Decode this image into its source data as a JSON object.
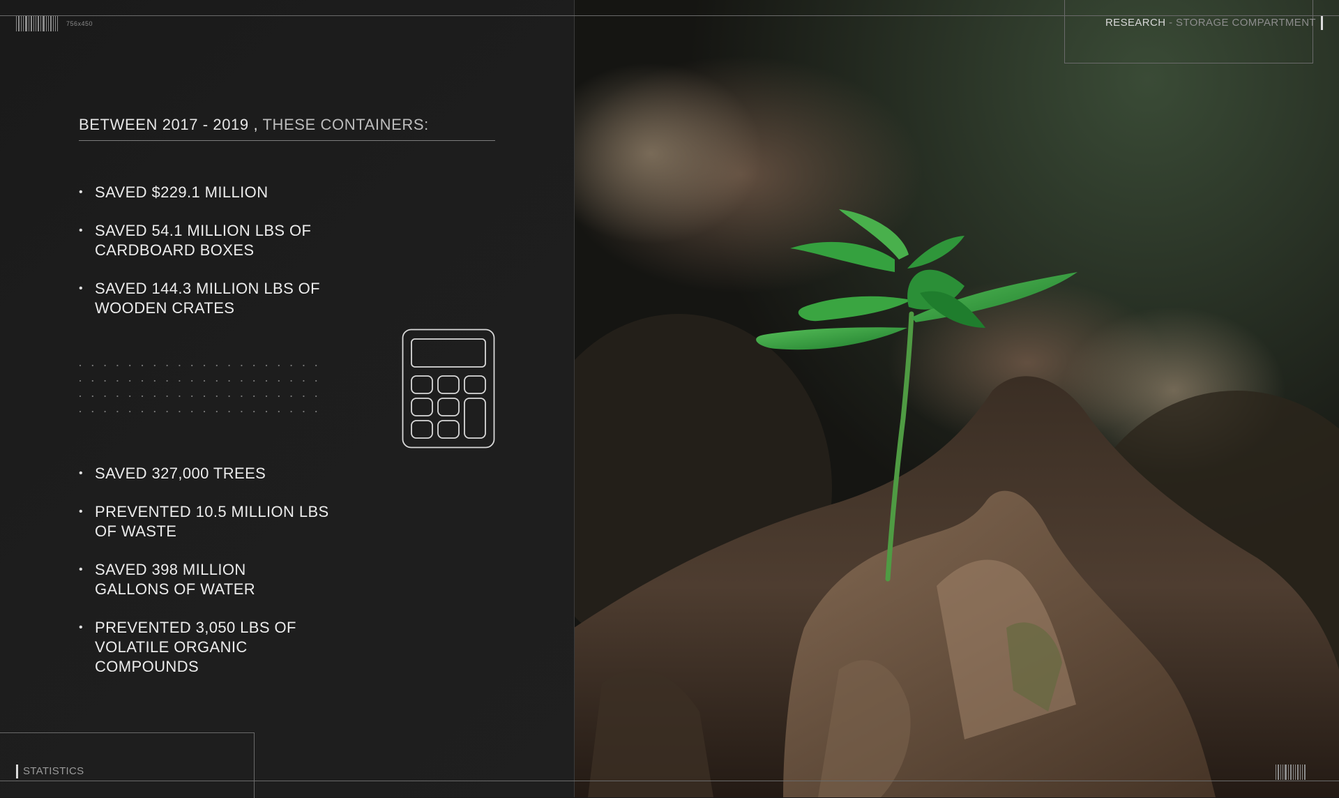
{
  "header": {
    "dimensions_label": "756x450",
    "section_bold": "RESEARCH",
    "section_separator": " - ",
    "section_light": "STORAGE COMPARTMENT"
  },
  "heading": {
    "bold": "BETWEEN 2017 - 2019 ,",
    "light": " THESE CONTAINERS:"
  },
  "stats_top": [
    {
      "line1": "SAVED $229.1 MILLION",
      "line2": ""
    },
    {
      "line1": "SAVED 54.1 MILLION LBS OF",
      "line2": "CARDBOARD BOXES"
    },
    {
      "line1": "SAVED 144.3 MILLION LBS OF",
      "line2": "WOODEN CRATES"
    }
  ],
  "stats_bottom": [
    {
      "line1": "SAVED 327,000 TREES",
      "line2": "",
      "line3": ""
    },
    {
      "line1": "PREVENTED 10.5 MILLION LBS",
      "line2": "OF WASTE",
      "line3": ""
    },
    {
      "line1": "SAVED 398 MILLION",
      "line2": "GALLONS OF WATER",
      "line3": ""
    },
    {
      "line1": "PREVENTED 3,050 LBS OF",
      "line2": "VOLATILE ORGANIC",
      "line3": "COMPOUNDS"
    }
  ],
  "footer": {
    "label": "STATISTICS"
  },
  "icons": {
    "calculator": "calculator-icon",
    "photo": "seedling-photo"
  },
  "colors": {
    "background": "#191919",
    "text": "#ececec",
    "leaf": "#2f9a3c"
  }
}
